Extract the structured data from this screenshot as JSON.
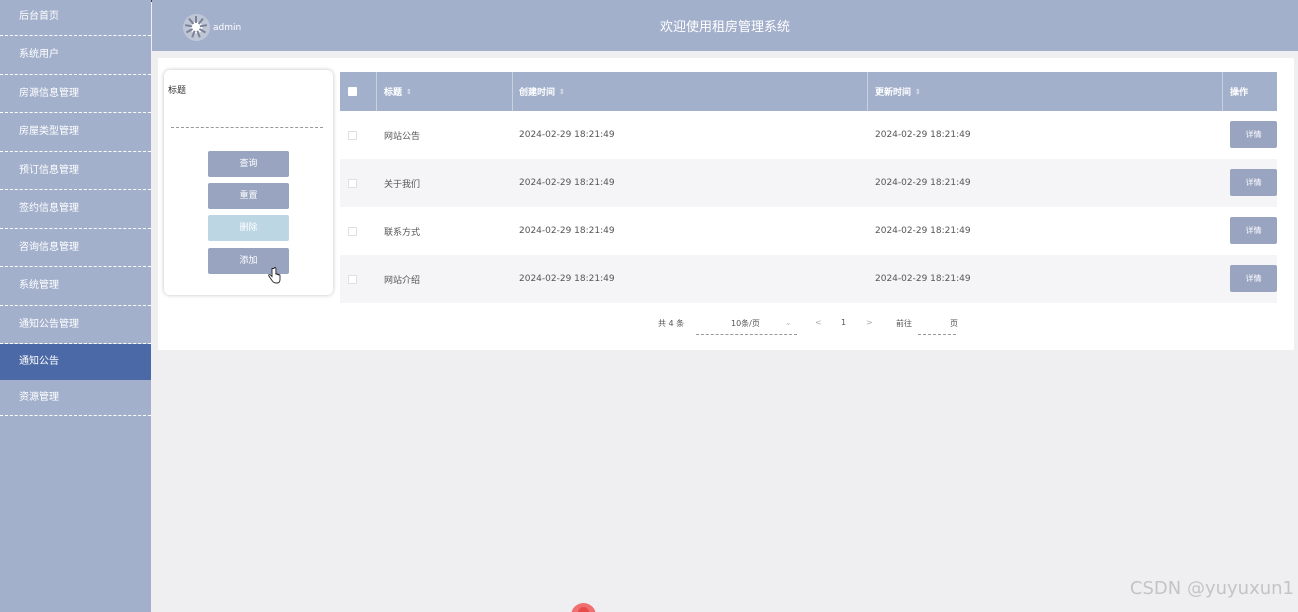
{
  "sidebar": {
    "items": [
      {
        "label": "后台首页"
      },
      {
        "label": "系统用户"
      },
      {
        "label": "房源信息管理"
      },
      {
        "label": "房屋类型管理"
      },
      {
        "label": "预订信息管理"
      },
      {
        "label": "签约信息管理"
      },
      {
        "label": "咨询信息管理"
      },
      {
        "label": "系统管理"
      },
      {
        "label": "通知公告管理"
      },
      {
        "label": "通知公告",
        "active": true
      },
      {
        "label": "资源管理"
      }
    ]
  },
  "header": {
    "username": "admin",
    "title": "欢迎使用租房管理系统"
  },
  "search": {
    "field_label": "标题",
    "buttons": {
      "query": "查询",
      "reset": "重置",
      "delete": "删除",
      "add": "添加"
    }
  },
  "table": {
    "columns": [
      "标题",
      "创建时间",
      "更新时间",
      "操作"
    ],
    "sort_icon": "⇕",
    "rows": [
      {
        "title": "网站公告",
        "created": "2024-02-29 18:21:49",
        "updated": "2024-02-29 18:21:49",
        "action": "详情"
      },
      {
        "title": "关于我们",
        "created": "2024-02-29 18:21:49",
        "updated": "2024-02-29 18:21:49",
        "action": "详情"
      },
      {
        "title": "联系方式",
        "created": "2024-02-29 18:21:49",
        "updated": "2024-02-29 18:21:49",
        "action": "详情"
      },
      {
        "title": "网站介绍",
        "created": "2024-02-29 18:21:49",
        "updated": "2024-02-29 18:21:49",
        "action": "详情"
      }
    ]
  },
  "pagination": {
    "total": "共 4 条",
    "page_size": "10条/页",
    "prev": "<",
    "current": "1",
    "next": ">",
    "goto": "前往",
    "page_unit": "页"
  },
  "watermark": "CSDN @yuyuxun1"
}
